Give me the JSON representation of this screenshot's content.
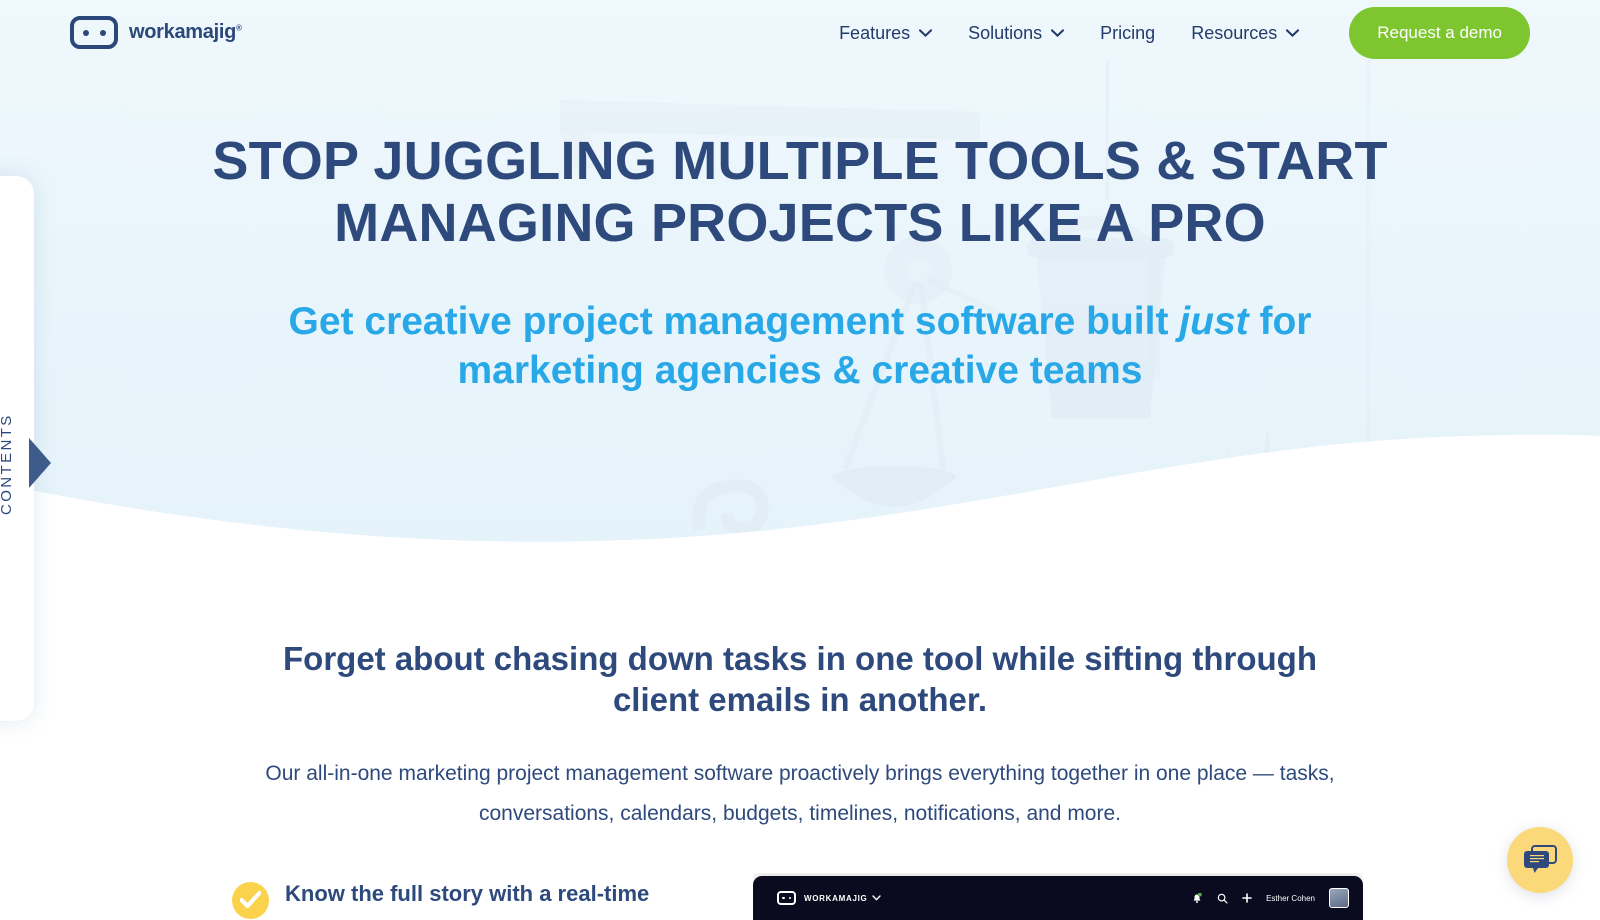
{
  "header": {
    "logo": {
      "text": "workamajig",
      "registered": "®",
      "icon": "workamajig-robot-logo"
    },
    "nav": [
      {
        "label": "Features",
        "has_dropdown": true
      },
      {
        "label": "Solutions",
        "has_dropdown": true
      },
      {
        "label": "Pricing",
        "has_dropdown": false
      },
      {
        "label": "Resources",
        "has_dropdown": true
      }
    ],
    "cta": {
      "label": "Request a demo",
      "color": "#7dc62f"
    }
  },
  "hero": {
    "headline": "STOP JUGGLING MULTIPLE TOOLS & START MANAGING PROJECTS LIKE A PRO",
    "subheadline_pre": "Get creative project management software built ",
    "subheadline_em": "just",
    "subheadline_post": " for marketing agencies & creative teams",
    "headline_color": "#2e4a7d",
    "subheadline_color": "#29a8e8",
    "background_color": "#e9f5fb",
    "illustration": "balance-scale-bucket-pulley-grass"
  },
  "contents_tab": {
    "label": "CONTENTS",
    "arrow_icon": "triangle-right-icon"
  },
  "main": {
    "section_heading": "Forget about chasing down tasks in one tool while sifting through client emails in another.",
    "paragraph": "Our all-in-one marketing project management software proactively brings everything together in one place — tasks, conversations, calendars, budgets, timelines, notifications, and more.",
    "bullets": [
      {
        "icon": "check-circle-icon",
        "icon_color": "#fbd24b",
        "text": "Know the full story with a real-time"
      }
    ]
  },
  "app_screenshot": {
    "logo_text": "WORKAMAJIG",
    "chevron_icon": "chevron-down-icon",
    "icons": [
      "bell-icon",
      "search-icon",
      "plus-icon"
    ],
    "user_name": "Esther Cohen",
    "avatar": "user-avatar"
  },
  "chat_widget": {
    "icon": "chat-bubble-icon",
    "background": "#fbd97a",
    "icon_color": "#2e4a7d"
  }
}
